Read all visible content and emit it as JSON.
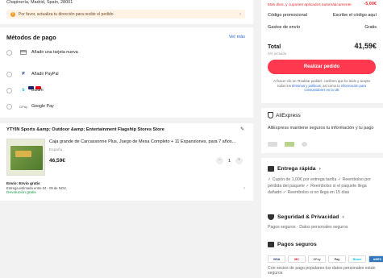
{
  "address": {
    "line": "Chapinería, Madrid, Spain, 28001",
    "warning": "Por favor, actualiza tu dirección para recibir el pedido"
  },
  "payment": {
    "title": "Métodos de pago",
    "see_more": "Ver más",
    "methods": [
      {
        "label": "Añadir una tarjeta nueva",
        "icon": "credit-card-icon"
      },
      {
        "label": "Añadir PayPal",
        "icon": "paypal-icon"
      },
      {
        "label": "Bizum",
        "icon": "bizum-icon"
      },
      {
        "label": "Google Pay",
        "icon": "google-pay-icon"
      }
    ]
  },
  "store": {
    "name": "YTYIN Sports &amp; Outdoor &amp; Entertainment Flagship Stores Store",
    "product": {
      "name": "Caja grande de Carcassonne Plus, Juego de Mesa Completo + 11 Expansiones, para 7 años...",
      "seller": "España",
      "price": "46,59€",
      "quantity": "1"
    },
    "shipping": {
      "free": "Envío: Envío gratis",
      "estimate": "Entrega estimada entre 04 - 09 de NOV.",
      "returns": "Devolución gratis"
    }
  },
  "summary": {
    "discount_note": "Más dtos. y cupones aplicados automáticamente",
    "discount": "-5,00€",
    "promo_label": "Código promocional",
    "promo_action": "Escribe el código aquí",
    "shipping_label": "Gastos de envío",
    "shipping_value": "Gratis",
    "total_label": "Total",
    "total_value": "41,59€",
    "iva": "IVA incluido",
    "order_button": "Realizar pedido",
    "legal_prefix": "Al hacer clic en 'Realizar pedido', confirmo que he leído y acepto todos los",
    "legal_terms": "términos y políticas",
    "legal_mid": ", así como la",
    "legal_info": "información para consumidores en la UE"
  },
  "aliexpress": {
    "brand": "AliExpress",
    "text": "AliExpress mantiene seguros tu información y tu pago"
  },
  "features": {
    "delivery_title": "Entrega rápida",
    "delivery_text": "✓ Cupón de 1,00€ por entrega tardía ✓ Reembolso por pérdida del paquete ✓ Reembolso si el paquete llega dañado ✓ Reembolso si no llega en 15 días",
    "security_title": "Seguridad & Privacidad",
    "security_text": "Pagos seguros · Datos personales seguros",
    "secure_pay_title": "Pagos seguros",
    "secure_pay_text": "Con socios de pago populares tus datos personales están seguros",
    "pay_logos": [
      "VISA",
      "MC",
      "GPay",
      "Pay",
      "Bizum",
      "AMEX"
    ]
  }
}
